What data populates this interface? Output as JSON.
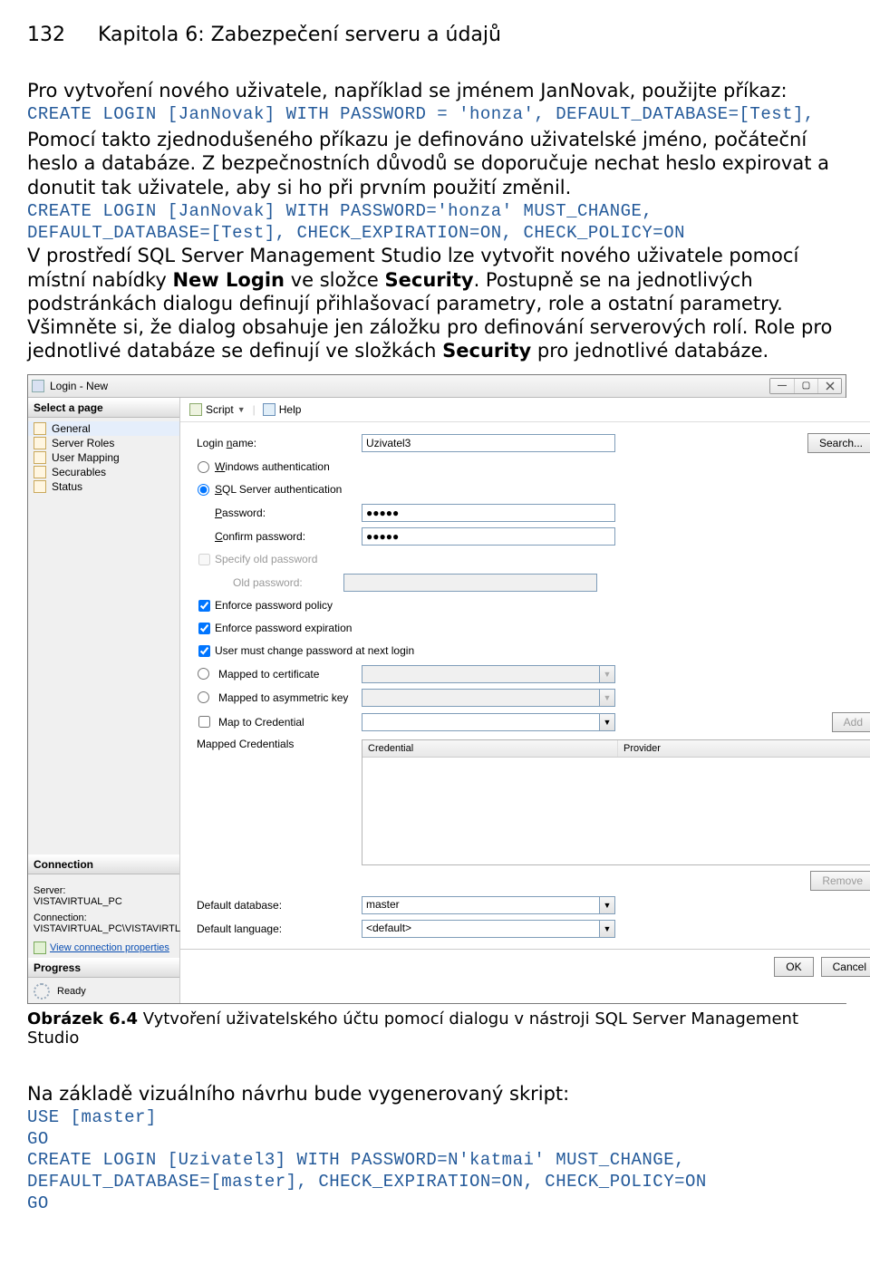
{
  "page_number": "132",
  "chapter_title": "Kapitola 6: Zabezpečení serveru a údajů",
  "para1": "Pro vytvoření nového uživatele, například se jménem JanNovak, použijte příkaz:",
  "code1": "CREATE LOGIN [JanNovak] WITH PASSWORD = 'honza', DEFAULT_DATABASE=[Test],",
  "para2": "Pomocí takto zjednodušeného příkazu je definováno uživatelské jméno, počáteční heslo a databáze. Z bezpečnostních důvodů se doporučuje nechat heslo expirovat a donutit tak uživatele, aby si ho při prvním použití změnil.",
  "code2a": "CREATE LOGIN [JanNovak] WITH PASSWORD='honza' MUST_CHANGE,",
  "code2b": "DEFAULT_DATABASE=[Test], CHECK_EXPIRATION=ON, CHECK_POLICY=ON",
  "para3a": "V prostředí SQL Server Management Studio lze vytvořit nového uživatele pomocí místní nabídky ",
  "para3b": "New Login",
  "para3c": " ve složce ",
  "para3d": "Security",
  "para3e": ". Postupně se na jednotlivých podstránkách dialogu definují přihlašovací parametry, role a ostatní parametry. Všimněte si, že dialog obsahuje jen záložku pro definování serverových rolí. Role pro jednotlivé databáze se definují ve složkách ",
  "para3f": "Security",
  "para3g": " pro jednotlivé databáze.",
  "caption_label": "Obrázek 6.4",
  "caption_text": " Vytvoření uživatelského účtu pomocí dialogu v nástroji SQL Server Management Studio",
  "para4": "Na základě vizuálního návrhu bude vygenerovaný skript:",
  "code3a": "USE [master]",
  "code3b": "GO",
  "code3c": "CREATE LOGIN [Uzivatel3] WITH PASSWORD=N'katmai' MUST_CHANGE,",
  "code3d": "DEFAULT_DATABASE=[master], CHECK_EXPIRATION=ON, CHECK_POLICY=ON",
  "code3e": "GO",
  "dlg": {
    "title": "Login - New",
    "select_page": "Select a page",
    "nav": {
      "general": "General",
      "server_roles": "Server Roles",
      "user_mapping": "User Mapping",
      "securables": "Securables",
      "status": "Status"
    },
    "conn": {
      "head": "Connection",
      "server_lab": "Server:",
      "server_val": "VISTAVIRTUAL_PC",
      "conn_lab": "Connection:",
      "conn_val": "VISTAVIRTUAL_PC\\VISTAVIRTL",
      "view_props": "View connection properties"
    },
    "progress": {
      "head": "Progress",
      "ready": "Ready"
    },
    "toolbar": {
      "script": "Script",
      "help": "Help"
    },
    "form": {
      "login_name_l": "Login name:",
      "login_name_v": "Uzivatel3",
      "search": "Search...",
      "win_auth": "Windows authentication",
      "sql_auth": "SQL Server authentication",
      "password_l": "Password:",
      "password_v": "●●●●●",
      "confirm_l": "Confirm password:",
      "confirm_v": "●●●●●",
      "specify_old": "Specify old password",
      "old_pass_l": "Old password:",
      "enforce_policy": "Enforce password policy",
      "enforce_exp": "Enforce password expiration",
      "must_change": "User must change password at next login",
      "mapped_cert": "Mapped to certificate",
      "mapped_asym": "Mapped to asymmetric key",
      "map_to_cred": "Map to Credential",
      "add": "Add",
      "mapped_creds": "Mapped Credentials",
      "col_cred": "Credential",
      "col_prov": "Provider",
      "remove": "Remove",
      "default_db_l": "Default database:",
      "default_db_v": "master",
      "default_lang_l": "Default language:",
      "default_lang_v": "<default>"
    },
    "ok": "OK",
    "cancel": "Cancel"
  }
}
